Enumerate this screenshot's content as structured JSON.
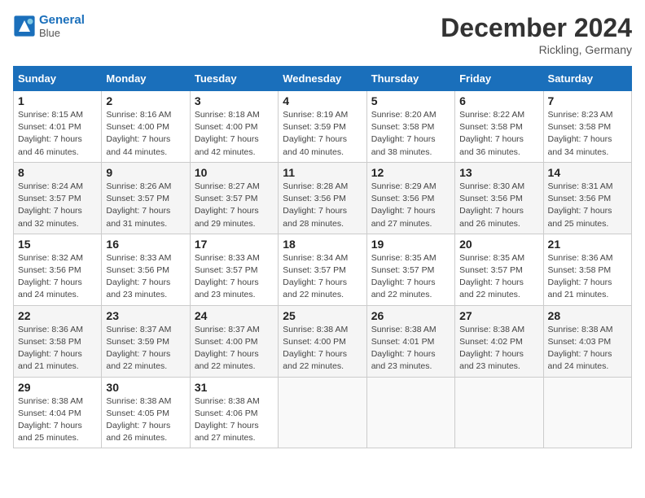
{
  "header": {
    "logo_line1": "General",
    "logo_line2": "Blue",
    "title": "December 2024",
    "subtitle": "Rickling, Germany"
  },
  "days_of_week": [
    "Sunday",
    "Monday",
    "Tuesday",
    "Wednesday",
    "Thursday",
    "Friday",
    "Saturday"
  ],
  "weeks": [
    [
      {
        "num": "1",
        "sunrise": "8:15 AM",
        "sunset": "4:01 PM",
        "daylight": "7 hours and 46 minutes."
      },
      {
        "num": "2",
        "sunrise": "8:16 AM",
        "sunset": "4:00 PM",
        "daylight": "7 hours and 44 minutes."
      },
      {
        "num": "3",
        "sunrise": "8:18 AM",
        "sunset": "4:00 PM",
        "daylight": "7 hours and 42 minutes."
      },
      {
        "num": "4",
        "sunrise": "8:19 AM",
        "sunset": "3:59 PM",
        "daylight": "7 hours and 40 minutes."
      },
      {
        "num": "5",
        "sunrise": "8:20 AM",
        "sunset": "3:58 PM",
        "daylight": "7 hours and 38 minutes."
      },
      {
        "num": "6",
        "sunrise": "8:22 AM",
        "sunset": "3:58 PM",
        "daylight": "7 hours and 36 minutes."
      },
      {
        "num": "7",
        "sunrise": "8:23 AM",
        "sunset": "3:58 PM",
        "daylight": "7 hours and 34 minutes."
      }
    ],
    [
      {
        "num": "8",
        "sunrise": "8:24 AM",
        "sunset": "3:57 PM",
        "daylight": "7 hours and 32 minutes."
      },
      {
        "num": "9",
        "sunrise": "8:26 AM",
        "sunset": "3:57 PM",
        "daylight": "7 hours and 31 minutes."
      },
      {
        "num": "10",
        "sunrise": "8:27 AM",
        "sunset": "3:57 PM",
        "daylight": "7 hours and 29 minutes."
      },
      {
        "num": "11",
        "sunrise": "8:28 AM",
        "sunset": "3:56 PM",
        "daylight": "7 hours and 28 minutes."
      },
      {
        "num": "12",
        "sunrise": "8:29 AM",
        "sunset": "3:56 PM",
        "daylight": "7 hours and 27 minutes."
      },
      {
        "num": "13",
        "sunrise": "8:30 AM",
        "sunset": "3:56 PM",
        "daylight": "7 hours and 26 minutes."
      },
      {
        "num": "14",
        "sunrise": "8:31 AM",
        "sunset": "3:56 PM",
        "daylight": "7 hours and 25 minutes."
      }
    ],
    [
      {
        "num": "15",
        "sunrise": "8:32 AM",
        "sunset": "3:56 PM",
        "daylight": "7 hours and 24 minutes."
      },
      {
        "num": "16",
        "sunrise": "8:33 AM",
        "sunset": "3:56 PM",
        "daylight": "7 hours and 23 minutes."
      },
      {
        "num": "17",
        "sunrise": "8:33 AM",
        "sunset": "3:57 PM",
        "daylight": "7 hours and 23 minutes."
      },
      {
        "num": "18",
        "sunrise": "8:34 AM",
        "sunset": "3:57 PM",
        "daylight": "7 hours and 22 minutes."
      },
      {
        "num": "19",
        "sunrise": "8:35 AM",
        "sunset": "3:57 PM",
        "daylight": "7 hours and 22 minutes."
      },
      {
        "num": "20",
        "sunrise": "8:35 AM",
        "sunset": "3:57 PM",
        "daylight": "7 hours and 22 minutes."
      },
      {
        "num": "21",
        "sunrise": "8:36 AM",
        "sunset": "3:58 PM",
        "daylight": "7 hours and 21 minutes."
      }
    ],
    [
      {
        "num": "22",
        "sunrise": "8:36 AM",
        "sunset": "3:58 PM",
        "daylight": "7 hours and 21 minutes."
      },
      {
        "num": "23",
        "sunrise": "8:37 AM",
        "sunset": "3:59 PM",
        "daylight": "7 hours and 22 minutes."
      },
      {
        "num": "24",
        "sunrise": "8:37 AM",
        "sunset": "4:00 PM",
        "daylight": "7 hours and 22 minutes."
      },
      {
        "num": "25",
        "sunrise": "8:38 AM",
        "sunset": "4:00 PM",
        "daylight": "7 hours and 22 minutes."
      },
      {
        "num": "26",
        "sunrise": "8:38 AM",
        "sunset": "4:01 PM",
        "daylight": "7 hours and 23 minutes."
      },
      {
        "num": "27",
        "sunrise": "8:38 AM",
        "sunset": "4:02 PM",
        "daylight": "7 hours and 23 minutes."
      },
      {
        "num": "28",
        "sunrise": "8:38 AM",
        "sunset": "4:03 PM",
        "daylight": "7 hours and 24 minutes."
      }
    ],
    [
      {
        "num": "29",
        "sunrise": "8:38 AM",
        "sunset": "4:04 PM",
        "daylight": "7 hours and 25 minutes."
      },
      {
        "num": "30",
        "sunrise": "8:38 AM",
        "sunset": "4:05 PM",
        "daylight": "7 hours and 26 minutes."
      },
      {
        "num": "31",
        "sunrise": "8:38 AM",
        "sunset": "4:06 PM",
        "daylight": "7 hours and 27 minutes."
      },
      null,
      null,
      null,
      null
    ]
  ],
  "labels": {
    "sunrise": "Sunrise:",
    "sunset": "Sunset:",
    "daylight": "Daylight:"
  }
}
